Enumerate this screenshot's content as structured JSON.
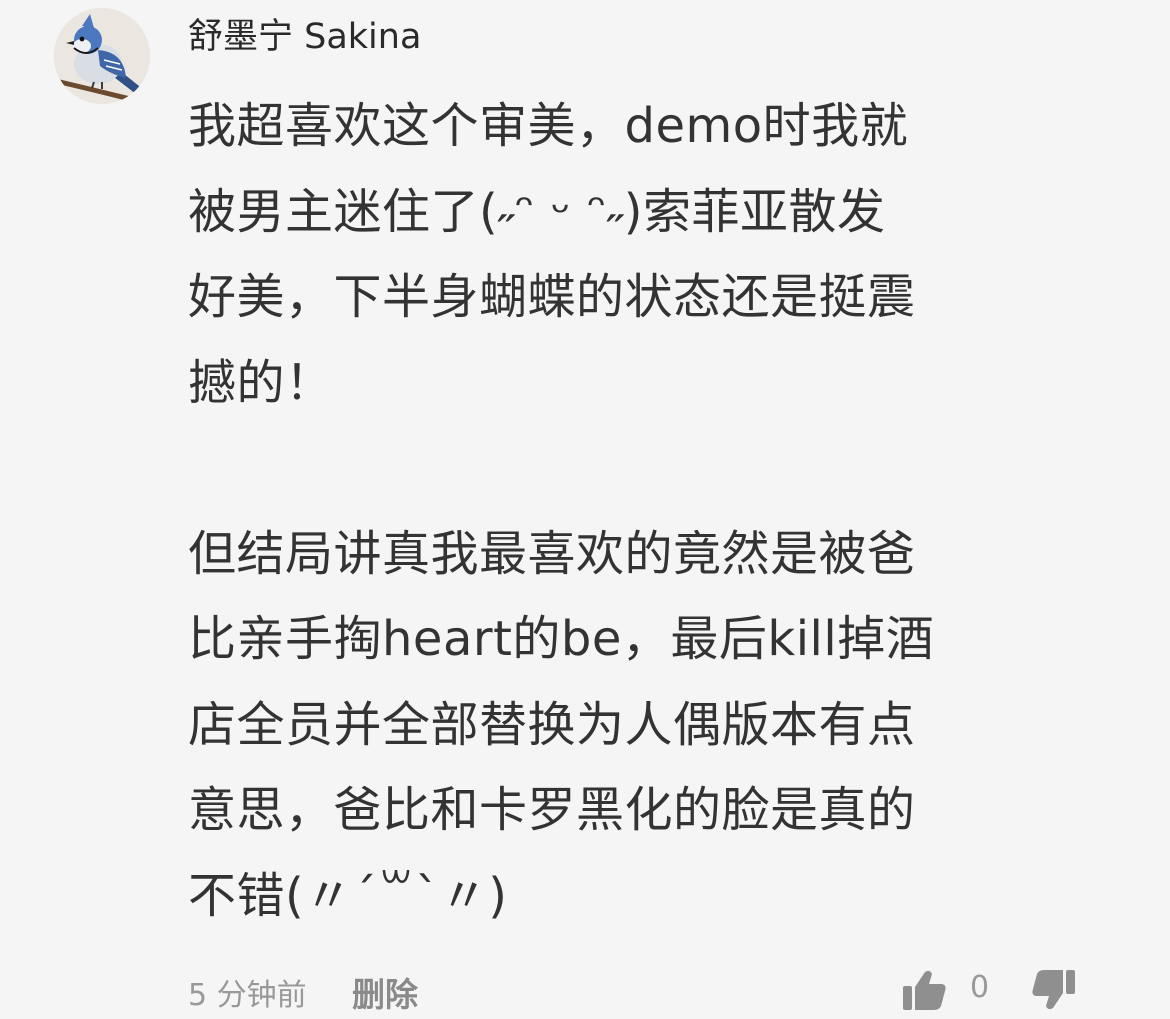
{
  "comment": {
    "avatar_icon": "blue-jay-bird-avatar",
    "username": "舒墨宁 Sakina",
    "paragraph1": [
      "我超喜欢这个审美，demo时我就",
      "被男主迷住了(˶ᵔ ᵕ ᵔ˶)索菲亚散发",
      "好美，下半身蝴蝶的状态还是挺震",
      "撼的！"
    ],
    "paragraph2": [
      "但结局讲真我最喜欢的竟然是被爸",
      "比亲手掏heart的be，最后kill掉酒",
      "店全员并全部替换为人偶版本有点",
      "意思，爸比和卡罗黑化的脸是真的",
      "不错(〃´꒳`〃)"
    ],
    "time": "5 分钟前",
    "delete_label": "删除",
    "like_icon": "thumbs-up-icon",
    "like_count": "0",
    "dislike_icon": "thumbs-down-icon"
  }
}
